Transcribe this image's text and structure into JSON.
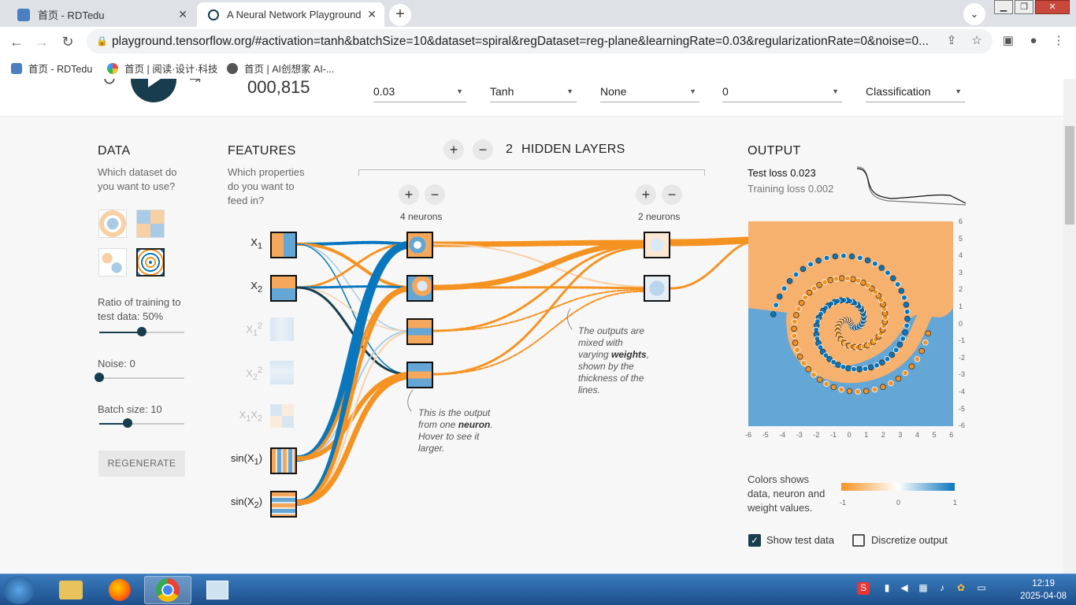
{
  "browser": {
    "tabs": [
      {
        "title": "首页 - RDTedu"
      },
      {
        "title": "A Neural Network Playground"
      }
    ],
    "url": "playground.tensorflow.org/#activation=tanh&batchSize=10&dataset=spiral&regDataset=reg-plane&learningRate=0.03&regularizationRate=0&noise=0...",
    "bookmarks": [
      {
        "label": "首页 - RDTedu"
      },
      {
        "label": "首页 | 阅读·设计·科技"
      },
      {
        "label": "首页 | AI创想家 AI-..."
      }
    ]
  },
  "controls": {
    "iterations": "000,815",
    "learning_rate": "0.03",
    "activation": "Tanh",
    "regularization": "None",
    "regularization_rate": "0",
    "problem_type": "Classification"
  },
  "data_panel": {
    "title": "DATA",
    "question": "Which dataset do you want to use?",
    "ratio_label": "Ratio of training to test data:  50%",
    "ratio_value": 0.5,
    "noise_label": "Noise:  0",
    "noise_value": 0,
    "batch_label": "Batch size:  10",
    "batch_value": 0.33,
    "regenerate": "REGENERATE"
  },
  "features": {
    "title": "FEATURES",
    "question": "Which properties do you want to feed in?"
  },
  "hidden": {
    "count": "2",
    "label": "HIDDEN LAYERS",
    "layer1_neurons": "4 neurons",
    "layer2_neurons": "2 neurons",
    "note_neuron_pre": "This is the output from one",
    "note_neuron_bold": "neuron",
    "note_neuron_post": ". Hover to see it larger.",
    "note_weights_pre": "The outputs are mixed with varying",
    "note_weights_bold": "weights",
    "note_weights_post": ", shown by the thickness of the lines."
  },
  "output": {
    "title": "OUTPUT",
    "test_loss_label": "Test loss",
    "test_loss": "0.023",
    "train_loss_label": "Training loss",
    "train_loss": "0.002",
    "y_ticks": [
      "6",
      "5",
      "4",
      "3",
      "2",
      "1",
      "0",
      "-1",
      "-2",
      "-3",
      "-4",
      "-5",
      "-6"
    ],
    "x_ticks": [
      "-6",
      "-5",
      "-4",
      "-3",
      "-2",
      "-1",
      "0",
      "1",
      "2",
      "3",
      "4",
      "5",
      "6"
    ],
    "legend_text": "Colors shows data, neuron and weight values.",
    "legend_ticks": [
      "-1",
      "0",
      "1"
    ],
    "show_test": "Show test data",
    "discretize": "Discretize output"
  },
  "taskbar": {
    "time": "12:19",
    "date": "2025-04-08"
  },
  "colors": {
    "orange": "#f59322",
    "blue": "#0877bd",
    "dark": "#183d4e"
  }
}
